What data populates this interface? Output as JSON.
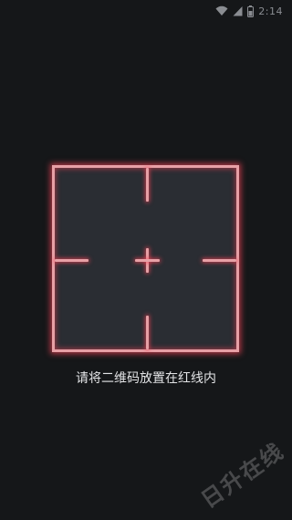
{
  "status_bar": {
    "time": "2:14",
    "icons": [
      "wifi-icon",
      "signal-icon",
      "battery-icon"
    ]
  },
  "scanner": {
    "hint": "请将二维码放置在红线内",
    "frame_color": "#e7a0a6",
    "glow_color": "#ff4660"
  },
  "watermark": {
    "text": "日升在线"
  }
}
